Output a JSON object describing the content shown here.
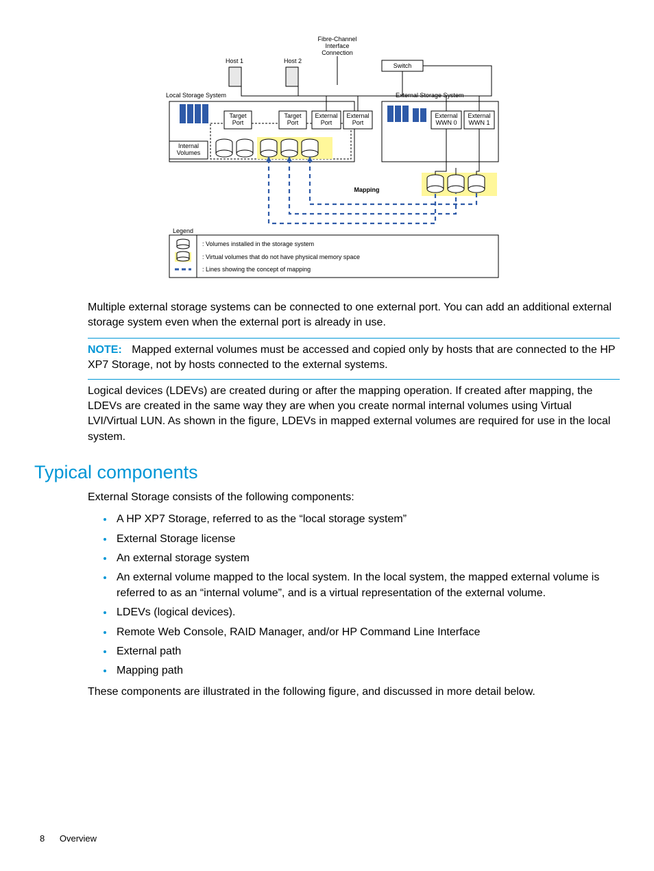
{
  "diagram": {
    "fibre_channel": "Fibre-Channel\nInterface\nConnection",
    "host1": "Host 1",
    "host2": "Host 2",
    "switch": "Switch",
    "local_storage": "Local Storage System",
    "external_storage": "External Storage System",
    "target_port_a": "Target\nPort",
    "target_port_b": "Target\nPort",
    "external_port_a": "External\nPort",
    "external_port_b": "External\nPort",
    "external_wwn0": "External\nWWN 0",
    "external_wwn1": "External\nWWN 1",
    "internal_volumes": "Internal\nVolumes",
    "mapping": "Mapping",
    "legend_title": "Legend",
    "legend_line1": ": Volumes installed in the storage system",
    "legend_line2": ": Virtual volumes that do not have physical memory space",
    "legend_line3": ": Lines showing the concept of mapping"
  },
  "para1": "Multiple external storage systems can be connected to one external port. You can add an additional external storage system even when the external port is already in use.",
  "note_label": "NOTE:",
  "note_text": "Mapped external volumes must be accessed and copied only by hosts that are connected to the HP XP7 Storage, not by hosts connected to the external systems.",
  "para2": "Logical devices (LDEVs) are created during or after the mapping operation. If created after mapping, the LDEVs are created in the same way they are when you create normal internal volumes using Virtual LVI/Virtual LUN. As shown in the figure, LDEVs in mapped external volumes are required for use in the local system.",
  "section_title": "Typical components",
  "para3": "External Storage consists of the following components:",
  "bullets": [
    "A HP XP7 Storage, referred to as the “local storage system”",
    "External Storage license",
    "An external storage system",
    "An external volume mapped to the local system. In the local system, the mapped external volume is referred to as an “internal volume”, and is a virtual representation of the external volume.",
    "LDEVs (logical devices).",
    "Remote Web Console, RAID Manager, and/or HP Command Line Interface",
    "External path",
    "Mapping path"
  ],
  "para4": "These components are illustrated in the following figure, and discussed in more detail below.",
  "footer": {
    "page": "8",
    "section": "Overview"
  }
}
